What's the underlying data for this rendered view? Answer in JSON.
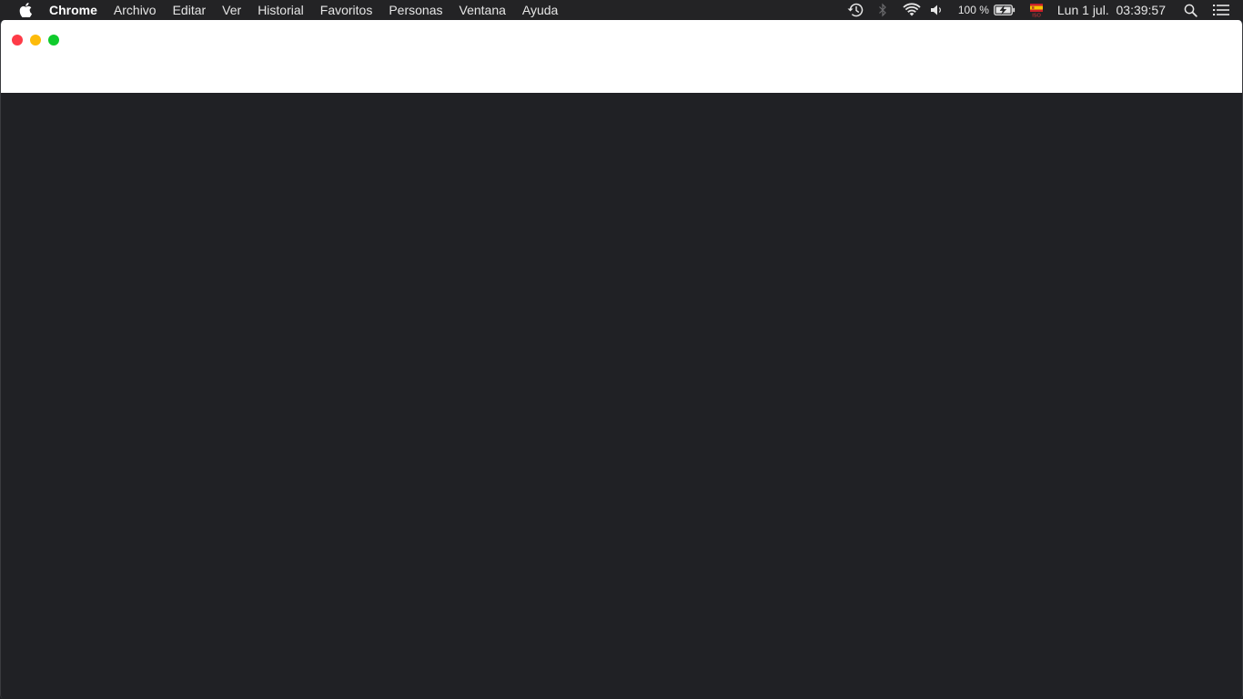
{
  "menubar": {
    "apple_icon": "apple-logo-icon",
    "app_name": "Chrome",
    "items": [
      {
        "label": "Archivo"
      },
      {
        "label": "Editar"
      },
      {
        "label": "Ver"
      },
      {
        "label": "Historial"
      },
      {
        "label": "Favoritos"
      },
      {
        "label": "Personas"
      },
      {
        "label": "Ventana"
      },
      {
        "label": "Ayuda"
      }
    ]
  },
  "status": {
    "icons": [
      "time-machine-icon",
      "bluetooth-icon",
      "wifi-icon",
      "volume-icon",
      "battery-charging-icon",
      "input-source-flag-icon",
      "spotlight-search-icon",
      "notification-center-icon"
    ],
    "battery_percent": "100 %",
    "input_source_label": "ISO",
    "clock": "Lun 1 jul.  03:39:57"
  },
  "window": {
    "controls": [
      "close",
      "minimize",
      "zoom"
    ],
    "colors": {
      "close": "#fe3b47",
      "minimize": "#fdbb0a",
      "zoom": "#0fcb2c",
      "content_background": "#202125",
      "titlebar_background": "#ffffff"
    }
  }
}
